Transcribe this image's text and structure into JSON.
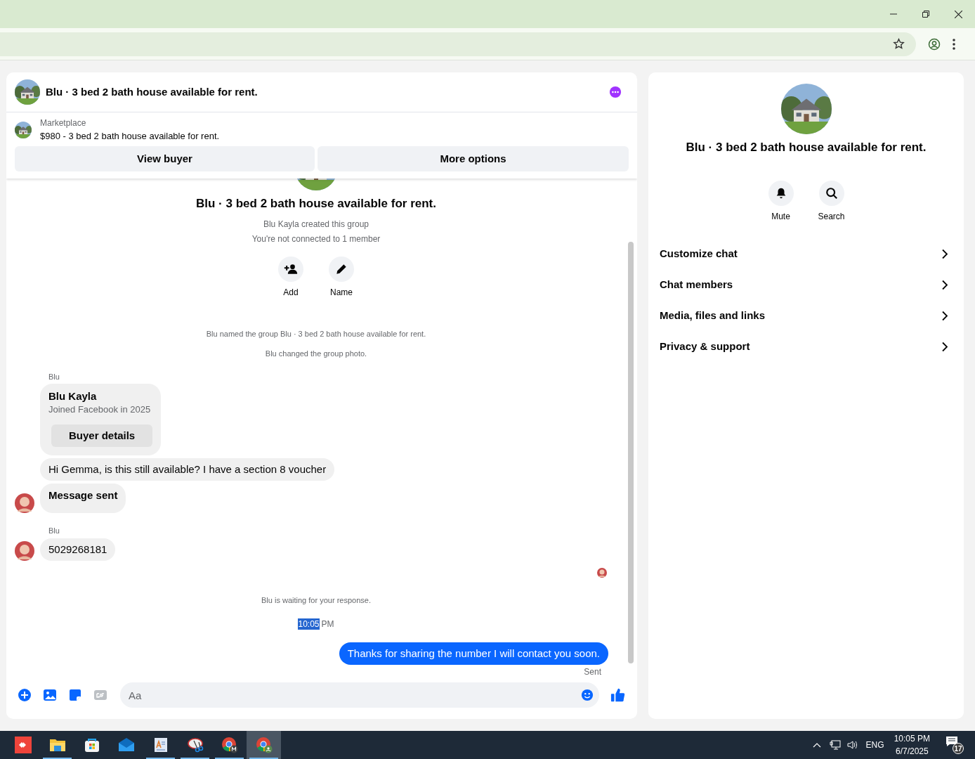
{
  "chat": {
    "title": "Blu · 3 bed 2 bath house available for rent.",
    "listing": {
      "label": "Marketplace",
      "title": "$980 - 3 bed 2 bath house available for rent."
    },
    "buttons": [
      "View buyer",
      "More options"
    ],
    "intro": {
      "title": "Blu · 3 bed 2 bath house available for rent.",
      "lines": [
        "Blu Kayla created this group",
        "You're not connected to 1 member"
      ],
      "actions": [
        {
          "kind": "add",
          "label": "Add"
        },
        {
          "kind": "name",
          "label": "Name"
        }
      ]
    },
    "messages": [
      {
        "kind": "system",
        "text": "Blu named the group Blu · 3 bed 2 bath house available for rent."
      },
      {
        "kind": "system",
        "text": "Blu changed the group photo."
      },
      {
        "kind": "sender",
        "text": "Blu"
      },
      {
        "kind": "card",
        "name": "Blu Kayla",
        "subtitle": "Joined Facebook in 2025",
        "button": "Buyer details"
      },
      {
        "kind": "incoming",
        "text": "Hi Gemma, is this still available?  I have a section 8 voucher",
        "avatar": false,
        "bold": false
      },
      {
        "kind": "incoming",
        "text": "Message sent",
        "avatar": true,
        "bold": true
      },
      {
        "kind": "sender",
        "text": "Blu"
      },
      {
        "kind": "incoming",
        "text": "5029268181",
        "avatar": true,
        "bold": false
      },
      {
        "kind": "seen"
      },
      {
        "kind": "notice",
        "text": "Blu is waiting for your response."
      },
      {
        "kind": "time",
        "parts": [
          {
            "text": "10:05",
            "highlighted": true
          },
          {
            "text": "PM",
            "highlighted": false
          }
        ]
      },
      {
        "kind": "outgoing",
        "text": "Thanks for sharing the number I will contact you soon.",
        "status": "Sent"
      }
    ],
    "composer": {
      "placeholder": "Aa"
    }
  },
  "details": {
    "title": "Blu · 3 bed 2 bath house available for rent.",
    "actions": [
      {
        "kind": "mute",
        "label": "Mute"
      },
      {
        "kind": "search",
        "label": "Search"
      }
    ],
    "items": [
      "Customize chat",
      "Chat members",
      "Media, files and links",
      "Privacy & support"
    ]
  },
  "taskbar": {
    "apps": [
      {
        "kind": "remote",
        "running": false,
        "active": false
      },
      {
        "kind": "folder",
        "running": true,
        "active": false
      },
      {
        "kind": "store",
        "running": false,
        "active": false
      },
      {
        "kind": "mail",
        "running": false,
        "active": false
      },
      {
        "kind": "document",
        "running": true,
        "active": false
      },
      {
        "kind": "scissors",
        "running": true,
        "active": false
      },
      {
        "kind": "browser_m",
        "running": true,
        "active": false
      },
      {
        "kind": "browser",
        "running": true,
        "active": true
      }
    ],
    "language": "ENG",
    "time": "10:05 PM",
    "date": "6/7/2025",
    "notifications": "17"
  }
}
